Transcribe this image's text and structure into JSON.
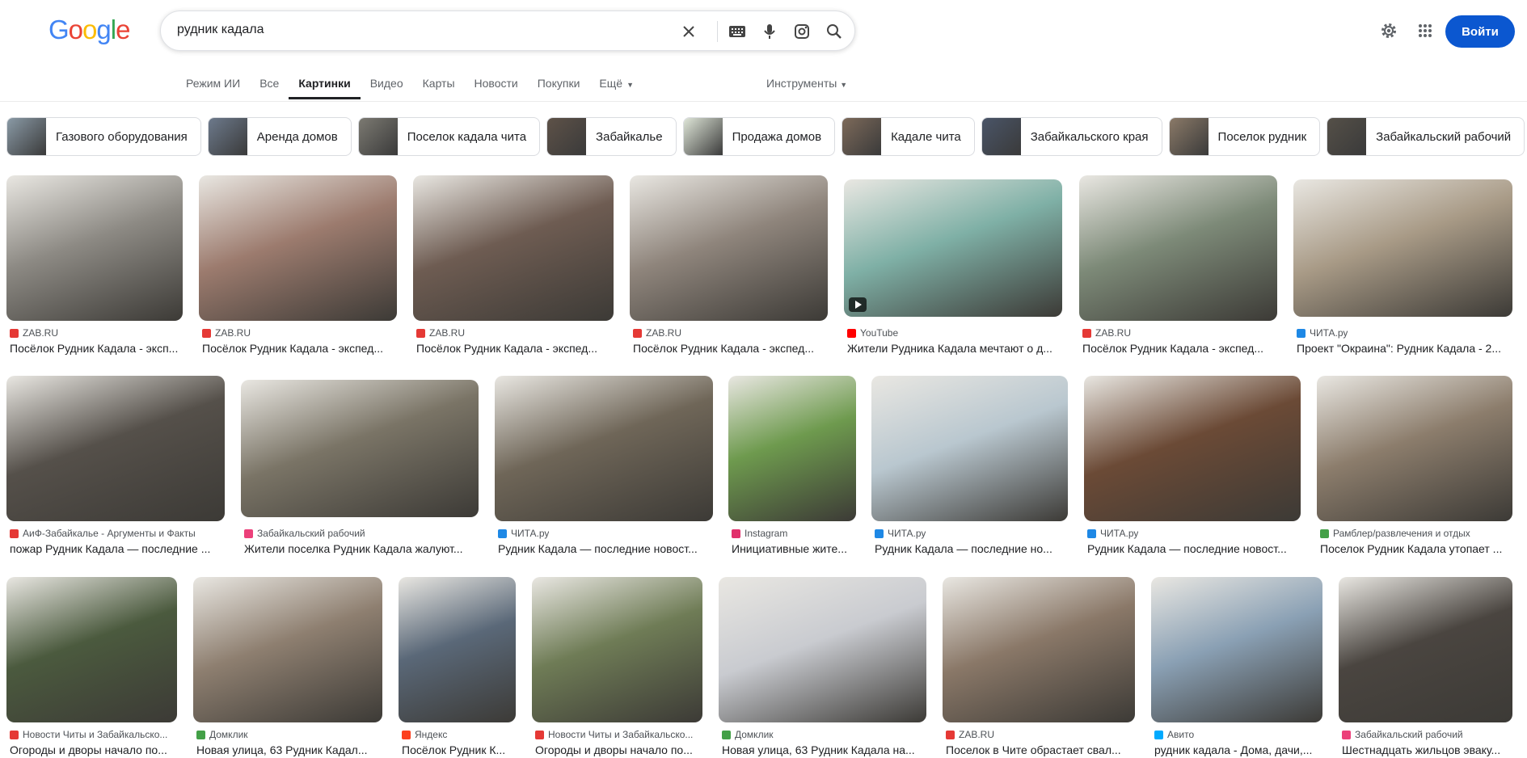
{
  "logo": {
    "text": "Google",
    "colors": [
      "#4285f4",
      "#ea4335",
      "#fbbc05",
      "#4285f4",
      "#34a853",
      "#ea4335"
    ]
  },
  "search": {
    "query": "рудник кадала"
  },
  "header": {
    "login_label": "Войти"
  },
  "tabs": [
    {
      "label": "Режим ИИ",
      "active": false
    },
    {
      "label": "Все",
      "active": false
    },
    {
      "label": "Картинки",
      "active": true
    },
    {
      "label": "Видео",
      "active": false
    },
    {
      "label": "Карты",
      "active": false
    },
    {
      "label": "Новости",
      "active": false
    },
    {
      "label": "Покупки",
      "active": false
    },
    {
      "label": "Ещё",
      "active": false
    }
  ],
  "tools_label": "Инструменты",
  "chips": [
    {
      "label": "Газового оборудования",
      "color": "#8a9aa6"
    },
    {
      "label": "Аренда домов",
      "color": "#6d7a8c"
    },
    {
      "label": "Поселок кадала чита",
      "color": "#7c7a72"
    },
    {
      "label": "Забайкалье",
      "color": "#5e5248"
    },
    {
      "label": "Продажа домов",
      "color": "#dfe6d8"
    },
    {
      "label": "Кадале чита",
      "color": "#7d6a5a"
    },
    {
      "label": "Забайкальского края",
      "color": "#4a5568"
    },
    {
      "label": "Поселок рудник",
      "color": "#8b7a68"
    },
    {
      "label": "Забайкальский рабочий",
      "color": "#555048"
    }
  ],
  "results": [
    {
      "source": "ZAB.RU",
      "title": "Посёлок Рудник Кадала - эксп...",
      "fav": "#e53935",
      "color": "#8d8a84"
    },
    {
      "source": "ZAB.RU",
      "title": "Посёлок Рудник Кадала - экспед...",
      "fav": "#e53935",
      "color": "#9c7b6e"
    },
    {
      "source": "ZAB.RU",
      "title": "Посёлок Рудник Кадала - экспед...",
      "fav": "#e53935",
      "color": "#6e5c52"
    },
    {
      "source": "ZAB.RU",
      "title": "Посёлок Рудник Кадала - экспед...",
      "fav": "#e53935",
      "color": "#8f857c"
    },
    {
      "source": "YouTube",
      "title": "Жители Рудника Кадала мечтают о д...",
      "fav": "#ff0000",
      "color": "#7fb0a6"
    },
    {
      "source": "ZAB.RU",
      "title": "Посёлок Рудник Кадала - экспед...",
      "fav": "#e53935",
      "color": "#7d8a78"
    },
    {
      "source": "ЧИТА.ру",
      "title": "Проект \"Окраина\": Рудник Кадала - 2...",
      "fav": "#1e88e5",
      "color": "#a89a86"
    },
    {
      "source": "АиФ-Забайкалье - Аргументы и Факты",
      "title": "пожар Рудник Кадала — последние ...",
      "fav": "#e53935",
      "color": "#55504a"
    },
    {
      "source": "Забайкальский рабочий",
      "title": "Жители поселка Рудник Кадала жалуют...",
      "fav": "#ec407a",
      "color": "#7a7466"
    },
    {
      "source": "ЧИТА.ру",
      "title": "Рудник Кадала — последние новост...",
      "fav": "#1e88e5",
      "color": "#6f6658"
    },
    {
      "source": "Instagram",
      "title": "Инициативные жите...",
      "fav": "#e1306c",
      "color": "#6e9a4e"
    },
    {
      "source": "ЧИТА.ру",
      "title": "Рудник Кадала — последние но...",
      "fav": "#1e88e5",
      "color": "#b9c7cf"
    },
    {
      "source": "ЧИТА.ру",
      "title": "Рудник Кадала — последние новост...",
      "fav": "#1e88e5",
      "color": "#6b4a36"
    },
    {
      "source": "Рамблер/развлечения и отдых",
      "title": "Поселок Рудник Кадала утопает ...",
      "fav": "#43a047",
      "color": "#8c7d6c"
    },
    {
      "source": "Новости Читы и Забайкальско...",
      "title": "Огороды и дворы начало по...",
      "fav": "#e53935",
      "color": "#4b5a3e"
    },
    {
      "source": "Домклик",
      "title": "Новая улица, 63 Рудник Кадал...",
      "fav": "#43a047",
      "color": "#8e7f70"
    },
    {
      "source": "Яндекс",
      "title": "Посёлок Рудник К...",
      "fav": "#fc3f1d",
      "color": "#5a6878"
    },
    {
      "source": "Новости Читы и Забайкальско...",
      "title": "Огороды и дворы начало по...",
      "fav": "#e53935",
      "color": "#6f7c56"
    },
    {
      "source": "Домклик",
      "title": "Новая улица, 63 Рудник Кадала на...",
      "fav": "#43a047",
      "color": "#c9cbd0"
    },
    {
      "source": "ZAB.RU",
      "title": "Поселок в Чите обрастает свал...",
      "fav": "#e53935",
      "color": "#8a7868"
    },
    {
      "source": "Авито",
      "title": "рудник кадала - Дома, дачи,...",
      "fav": "#00aaff",
      "color": "#8aa0b4"
    },
    {
      "source": "Забайкальский рабочий",
      "title": "Шестнадцать жильцов эваку...",
      "fav": "#ec407a",
      "color": "#4a4540"
    }
  ]
}
